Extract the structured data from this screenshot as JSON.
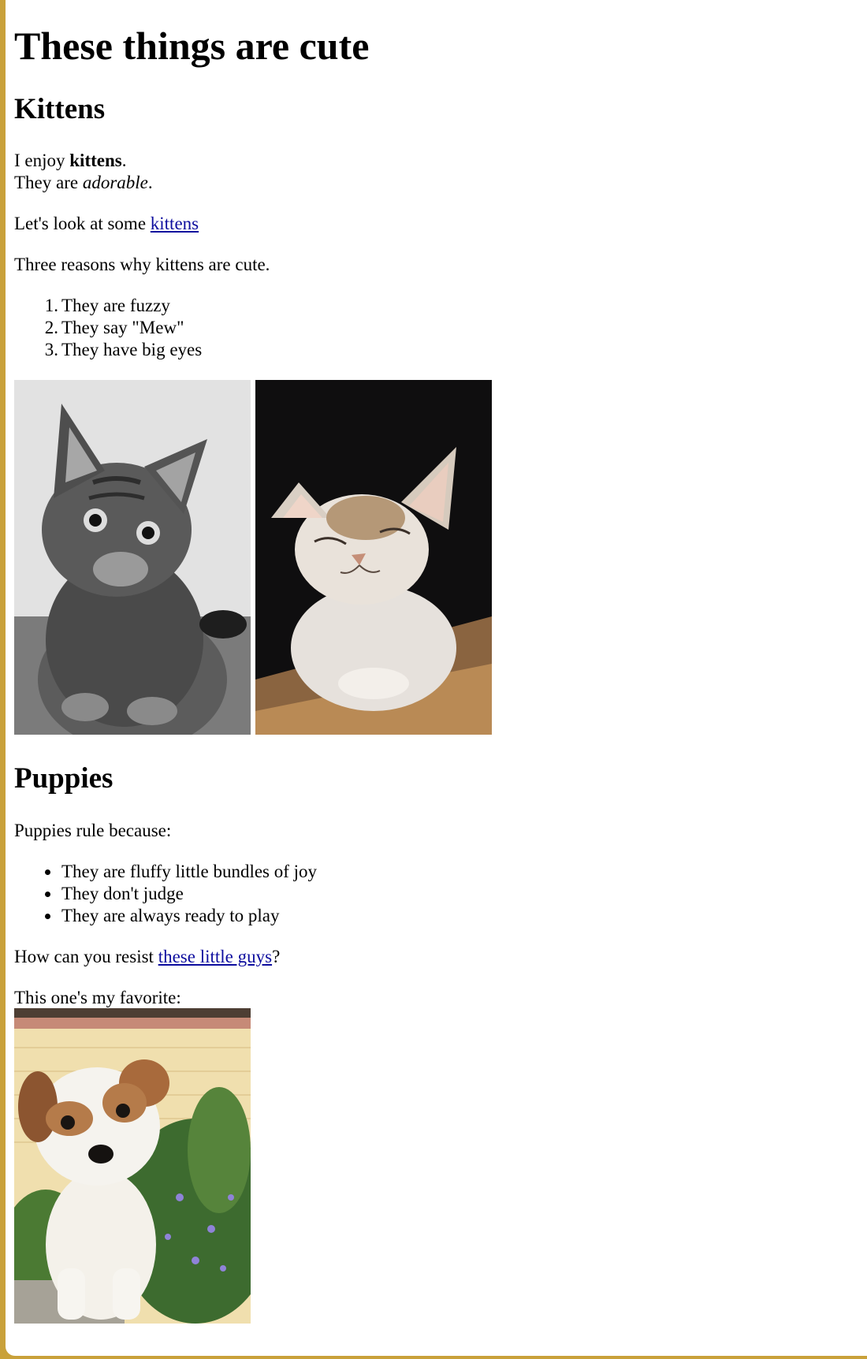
{
  "page": {
    "title": "These things are cute"
  },
  "kittens": {
    "heading": "Kittens",
    "enjoy_pre": "I enjoy ",
    "enjoy_bold": "kittens",
    "enjoy_post": ".",
    "adorable_pre": "They are ",
    "adorable_italic": "adorable",
    "adorable_post": ".",
    "look_pre": "Let's look at some ",
    "look_link": "kittens",
    "reasons_intro": "Three reasons why kittens are cute.",
    "reasons": [
      {
        "num": "1.",
        "text": "They are fuzzy"
      },
      {
        "num": "2.",
        "text": "They say \"Mew\""
      },
      {
        "num": "3.",
        "text": "They have big eyes"
      }
    ]
  },
  "puppies": {
    "heading": "Puppies",
    "intro": "Puppies rule because:",
    "reasons": [
      "They are fluffy little bundles of joy",
      "They don't judge",
      "They are always ready to play"
    ],
    "resist_pre": "How can you resist ",
    "resist_link": "these little guys",
    "resist_post": "?",
    "favorite": "This one's my favorite:"
  },
  "colors": {
    "link": "#0d0d9e",
    "frame": "#c9a13a"
  }
}
